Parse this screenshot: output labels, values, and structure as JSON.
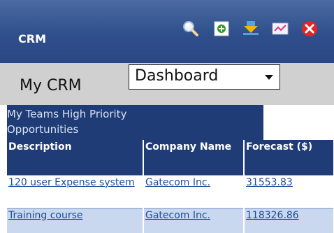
{
  "header": {
    "title": "CRM",
    "icons": [
      "search-icon",
      "add-icon",
      "download-icon",
      "chart-icon",
      "close-icon"
    ]
  },
  "toolbar": {
    "label": "My CRM",
    "view_select": "Dashboard"
  },
  "panel": {
    "title": "My Teams High Priority Opportunities"
  },
  "table": {
    "columns": [
      "Description",
      "Company Name",
      "Forecast ($)"
    ],
    "rows": [
      [
        "120 user Expense system",
        "Gatecom Inc.",
        "31553.83"
      ],
      [
        "Training course",
        "Gatecom Inc.",
        "118326.86"
      ]
    ]
  },
  "colors": {
    "header": "#2f4f8c",
    "panel": "#1f3c76",
    "link": "#1a4d9b"
  }
}
